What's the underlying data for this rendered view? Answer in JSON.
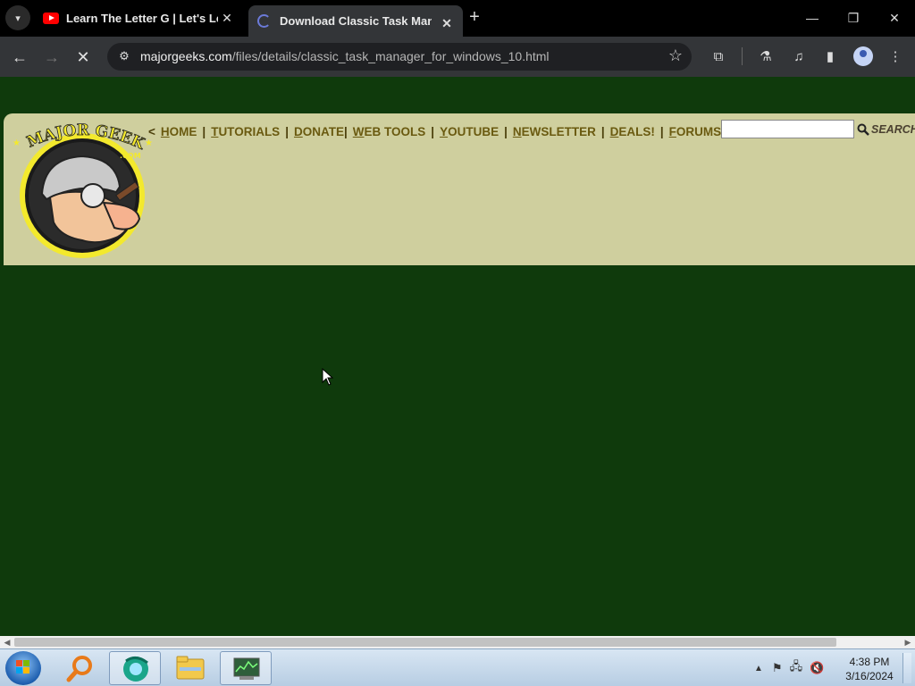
{
  "browser": {
    "tabs": [
      {
        "title": "Learn The Letter G | Let's Learn",
        "favicon": "youtube-icon",
        "active": false
      },
      {
        "title": "Download Classic Task Manager",
        "favicon": "loading-icon",
        "active": true
      }
    ],
    "url_host": "majorgeeks.com",
    "url_path": "/files/details/classic_task_manager_for_windows_10.html"
  },
  "site": {
    "nav": {
      "open": "<",
      "close": ">",
      "items": [
        {
          "first": "H",
          "rest": "OME"
        },
        {
          "first": "T",
          "rest": "UTORIALS"
        },
        {
          "first": "D",
          "rest": "ONATE"
        },
        {
          "first": "W",
          "rest": "EB TOOLS"
        },
        {
          "first": "Y",
          "rest": "OUTUBE"
        },
        {
          "first": "N",
          "rest": "EWSLETTER"
        },
        {
          "first": "D",
          "rest": "EALS!"
        },
        {
          "first": "F",
          "rest": "ORUMS"
        }
      ],
      "separators": [
        "|",
        "|",
        "|",
        "|",
        "|",
        "|",
        "|",
        "|"
      ]
    },
    "search_placeholder": "",
    "search_label": "SEARCH",
    "logo_text": "MAJOR GEEKS",
    "logo_sub": ".COM",
    "colors": {
      "page_bg": "#0f3a0c",
      "panel_bg": "#cfcf9e",
      "nav_text": "#6a5a10"
    }
  },
  "taskbar": {
    "time": "4:38 PM",
    "date": "3/16/2024"
  }
}
